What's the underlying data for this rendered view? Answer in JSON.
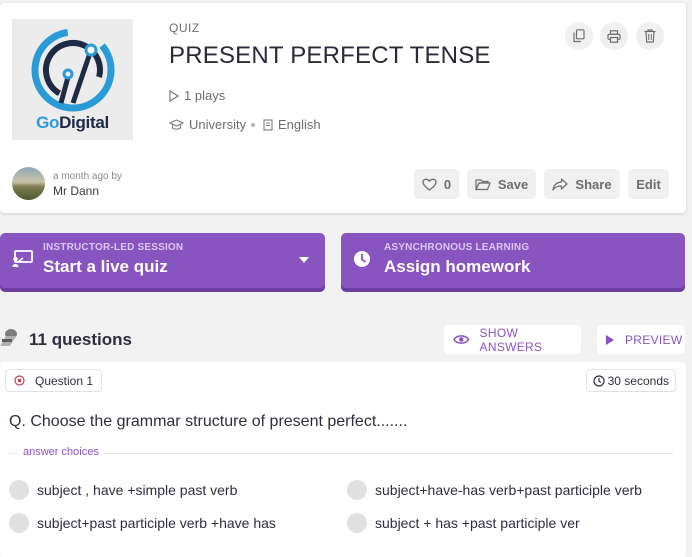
{
  "quiz": {
    "type_label": "QUIZ",
    "title": "PRESENT PERFECT TENSE",
    "plays": "1 plays",
    "grade": "University",
    "language": "English",
    "thumbnail_brand_go": "Go",
    "thumbnail_brand_digital": "Digital"
  },
  "author": {
    "when": "a month ago by",
    "name": "Mr Dann"
  },
  "actions": {
    "likes": "0",
    "save": "Save",
    "share": "Share",
    "edit": "Edit"
  },
  "sessions": {
    "live": {
      "kicker": "INSTRUCTOR-LED SESSION",
      "label": "Start a live quiz"
    },
    "homework": {
      "kicker": "ASYNCHRONOUS LEARNING",
      "label": "Assign homework"
    }
  },
  "questions_header": {
    "count": "11 questions",
    "show_answers": "SHOW ANSWERS",
    "preview": "PREVIEW"
  },
  "question": {
    "tag": "Question 1",
    "time": "30 seconds",
    "text": "Q. Choose the grammar structure of present perfect.......",
    "choices_label": "answer choices",
    "choices": [
      "subject , have +simple past verb",
      "subject+have-has verb+past participle verb",
      "subject+past participle verb +have has",
      "subject + has +past participle ver"
    ]
  },
  "colors": {
    "accent": "#8854c0",
    "accent_dark": "#6c3fa0",
    "brand_blue": "#2b9bd7",
    "brand_navy": "#1f2a44"
  }
}
